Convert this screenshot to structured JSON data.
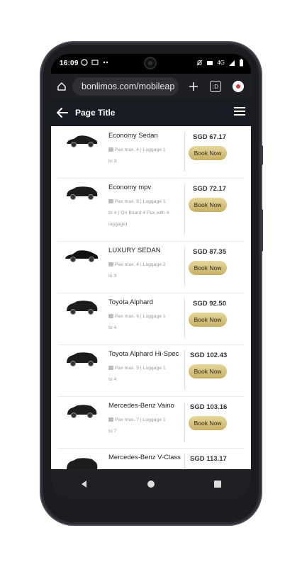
{
  "status": {
    "time": "16:09",
    "network": "4G"
  },
  "browser": {
    "url": "bonlimos.com/mobileap",
    "tab_count": ":D"
  },
  "appbar": {
    "title": "Page Title"
  },
  "book_label": "Book Now",
  "vehicles": [
    {
      "name": "Economy Sedan",
      "meta_line1": "Pax max. 4 |    Luggage 1",
      "meta_line2": "to 3",
      "meta_line3": "",
      "price": "SGD 67.17"
    },
    {
      "name": "Economy mpv",
      "meta_line1": "Pax max. 6 |    Luggage 1",
      "meta_line2": "to 4 ( On Board 4 Pax with 4",
      "meta_line3": "luggage)",
      "price": "SGD 72.17"
    },
    {
      "name": "LUXURY SEDAN",
      "meta_line1": "Pax max. 4 |    Luggage 2",
      "meta_line2": "to 3",
      "meta_line3": "",
      "price": "SGD 87.35"
    },
    {
      "name": "Toyota Alphard",
      "meta_line1": "Pax max. 6 |    Luggage 1",
      "meta_line2": "to 4",
      "meta_line3": "",
      "price": "SGD 92.50"
    },
    {
      "name": "Toyota Alphard Hi-Spec",
      "meta_line1": "Pax max. 5 |    Luggage 1",
      "meta_line2": "to 4",
      "meta_line3": "",
      "price": "SGD 102.43"
    },
    {
      "name": "Mercedes-Benz Vaino",
      "meta_line1": "Pax max. 7 |    Luggage 1",
      "meta_line2": "to 7",
      "meta_line3": "",
      "price": "SGD 103.16"
    },
    {
      "name": "Mercedes-Benz V-Class",
      "meta_line1": "",
      "meta_line2": "",
      "meta_line3": "",
      "price": "SGD 113.17"
    }
  ]
}
